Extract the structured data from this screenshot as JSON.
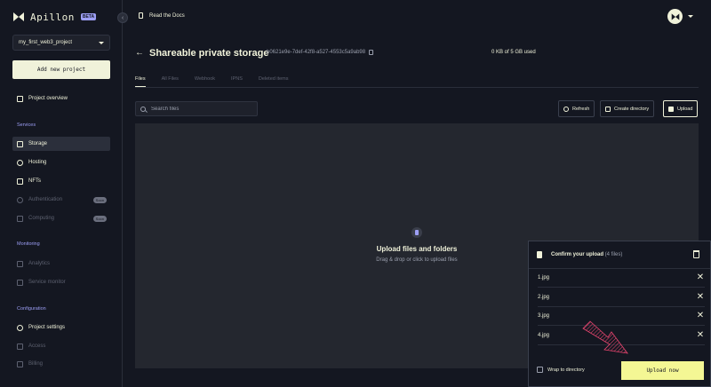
{
  "app": {
    "name": "Apillon",
    "beta": "BETA"
  },
  "sidebar": {
    "project": "my_first_web3_project",
    "add_project": "Add new project",
    "overview": "Project overview",
    "sections": {
      "services": "Services",
      "monitoring": "Monitoring",
      "configuration": "Configuration"
    },
    "services": [
      {
        "label": "Storage",
        "icon": "folder-icon",
        "active": true
      },
      {
        "label": "Hosting",
        "icon": "cloud-icon"
      },
      {
        "label": "NFTs",
        "icon": "nft-icon"
      },
      {
        "label": "Authentication",
        "icon": "user-icon",
        "disabled": true,
        "badge": "Soon"
      },
      {
        "label": "Computing",
        "icon": "computing-icon",
        "disabled": true,
        "badge": "Soon"
      }
    ],
    "monitoring": [
      {
        "label": "Analytics",
        "icon": "chart-icon",
        "disabled": true
      },
      {
        "label": "Service monitor",
        "icon": "monitor-icon",
        "disabled": true
      }
    ],
    "configuration": [
      {
        "label": "Project settings",
        "icon": "gear-icon"
      },
      {
        "label": "Access",
        "icon": "key-icon",
        "disabled": true
      },
      {
        "label": "Billing",
        "icon": "card-icon",
        "disabled": true
      }
    ]
  },
  "topbar": {
    "docs": "Read the Docs"
  },
  "header": {
    "title": "Shareable private storage",
    "bucket_id": "b0621e9e-7def-42f8-a527-4553c5a9ab98",
    "storage_used": "0 KB of 5 GB used"
  },
  "tabs": [
    "Files",
    "All Files",
    "Webhook",
    "IPNS",
    "Deleted items"
  ],
  "toolbar": {
    "search_placeholder": "Search files",
    "refresh": "Refresh",
    "create_directory": "Create directory",
    "upload": "Upload"
  },
  "dropzone": {
    "title": "Upload files and folders",
    "subtitle": "Drag & drop or click to upload files"
  },
  "upload_panel": {
    "title": "Confirm your upload",
    "count": "(4 files)",
    "files": [
      "1.jpg",
      "2.jpg",
      "3.jpg",
      "4.jpg"
    ],
    "wrap_label": "Wrap to directory",
    "upload_now": "Upload now"
  },
  "colors": {
    "background": "#141721",
    "accent_yellow": "#f4f794",
    "accent_purple": "#9d9ff6",
    "annotation": "#e8456f"
  }
}
